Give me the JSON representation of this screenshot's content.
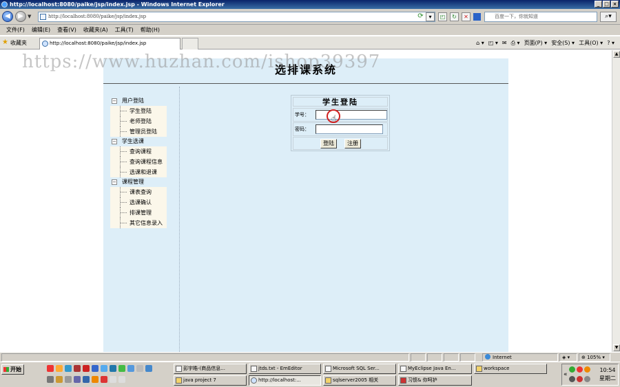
{
  "window": {
    "title": "http://localhost:8080/paike/jsp/index.jsp - Windows Internet Explorer",
    "controls": [
      "_",
      "□",
      "×"
    ]
  },
  "addressbar": {
    "url": "http://localhost:8080/paike/jsp/index.jsp",
    "search_placeholder": "百度一下，你就知道"
  },
  "menu": [
    "文件(F)",
    "编辑(E)",
    "查看(V)",
    "收藏夹(A)",
    "工具(T)",
    "帮助(H)"
  ],
  "tabbar": {
    "favorites": "收藏夹",
    "tab_title": "http://localhost:8080/paike/jsp/index.jsp",
    "commands": [
      "页面(P) ▾",
      "安全(S) ▾",
      "工具(O) ▾"
    ]
  },
  "watermark": "https://www.huzhan.com/ishop39397",
  "page": {
    "title": "选排课系统",
    "menu_groups": [
      {
        "label": "用户登陆",
        "items": [
          "学生登陆",
          "老师登陆",
          "管理员登陆"
        ]
      },
      {
        "label": "学生选课",
        "items": [
          "查询课程",
          "查询课程信息",
          "选课和退课"
        ]
      },
      {
        "label": "课程管理",
        "items": [
          "课表查询",
          "选课确认",
          "排课管理",
          "其它信息录入"
        ]
      }
    ],
    "login": {
      "title": "学生登陆",
      "student_id_label": "学号：",
      "password_label": "密码：",
      "login_button": "登陆",
      "register_button": "注册"
    }
  },
  "statusbar": {
    "zone": "Internet",
    "zoom": "105%"
  },
  "taskbar": {
    "start": "开始",
    "tasks_row1": [
      "彭宇皓-(商品信息...",
      "jtds.txt - EmEditor",
      "Microsoft SQL Ser...",
      "MyEclipse Java En...",
      "workspace"
    ],
    "tasks_row2": [
      "java project 7",
      "http://localhost:...",
      "sqlserver2005 相关",
      "习惯& 你呵护"
    ],
    "time": "10:54",
    "day": "星期二"
  },
  "colors": {
    "page_bg": "#ddeef8",
    "menu_bg": "#fbf7ea",
    "titlebar": "#0a246a"
  }
}
